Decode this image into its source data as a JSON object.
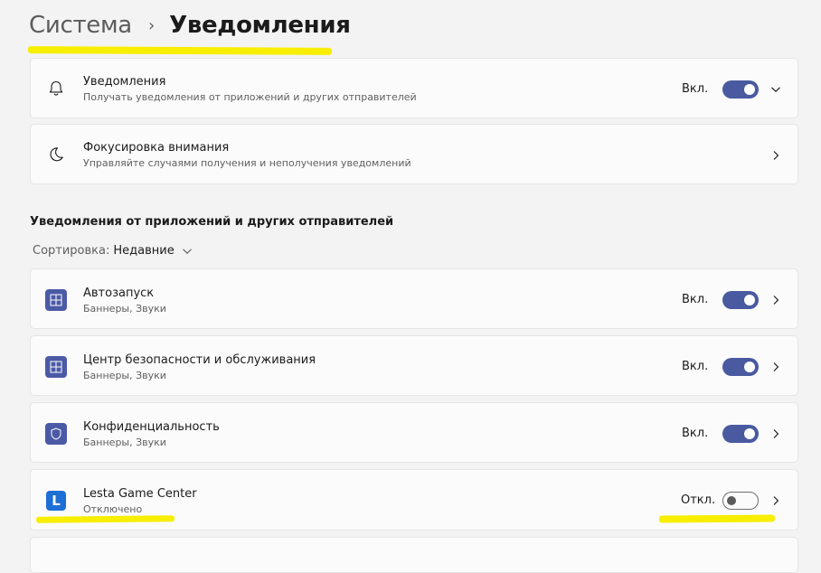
{
  "header": {
    "parent": "Система",
    "separator": "›",
    "current": "Уведомления"
  },
  "top_cards": [
    {
      "title": "Уведомления",
      "subtitle": "Получать уведомления от приложений и других отправителей",
      "state": "Вкл.",
      "toggle_on": true,
      "icon": "bell-icon",
      "chevron": "chevron-down-icon"
    },
    {
      "title": "Фокусировка внимания",
      "subtitle": "Управляйте случаями получения и неполучения уведомлений",
      "icon": "moon-icon",
      "chevron": "chevron-right-icon"
    }
  ],
  "apps_section": {
    "title": "Уведомления от приложений и других отправителей",
    "sort_label": "Сортировка:",
    "sort_value": "Недавние"
  },
  "apps": [
    {
      "name": "Автозапуск",
      "subtitle": "Баннеры, Звуки",
      "state": "Вкл.",
      "toggle_on": true,
      "icon": "app-grid-icon"
    },
    {
      "name": "Центр безопасности и обслуживания",
      "subtitle": "Баннеры, Звуки",
      "state": "Вкл.",
      "toggle_on": true,
      "icon": "app-grid-icon"
    },
    {
      "name": "Конфиденциальность",
      "subtitle": "Баннеры, Звуки",
      "state": "Вкл.",
      "toggle_on": true,
      "icon": "shield-icon"
    },
    {
      "name": "Lesta Game Center",
      "subtitle": "Отключено",
      "state": "Откл.",
      "toggle_on": false,
      "icon": "lesta-logo-icon",
      "icon_letter": "L"
    }
  ],
  "colors": {
    "accent": "#4a5aa0",
    "highlight": "#f8ee00",
    "background": "#f3f3f3",
    "card": "#fbfbfb"
  }
}
